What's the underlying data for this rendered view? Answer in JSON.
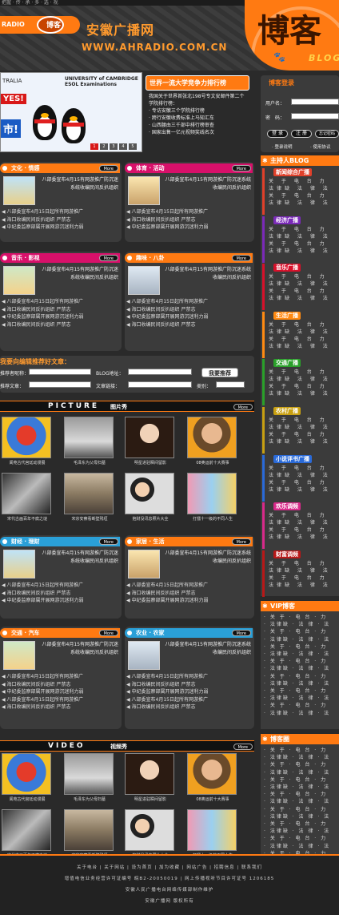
{
  "header": {
    "top_strip": "把握 · 传 · 承 · 多 · 选 · 视",
    "radio_logo_left": "RADIO",
    "radio_logo_right": "博客",
    "site_name": "安徽广播网",
    "site_url": "WWW.AHRADIO.COM.CN",
    "blog_big": "博客",
    "blog_small": "BLOG"
  },
  "banner": {
    "tralia": "TRALIA",
    "university": "UNIVERSITY of CAMBRIDGE ESOL Examinations",
    "yes_text": "YES!",
    "city_text": "市!",
    "pages": [
      "1",
      "2",
      "3",
      "4",
      "5"
    ]
  },
  "ranking": {
    "title": "世界一流大学竞争力排行榜",
    "intro": "我国关于世界首张北198号专文安邮件第二个学院排行榜：",
    "items": [
      "专访安徽三个学院排行榜",
      "跨行安徽收费标准上马知汇车",
      "山西腰由三千部中排行榜审查",
      "国家出售一亿元视频奖线名次"
    ]
  },
  "login": {
    "title": "博客登录",
    "user_label": "用户名：",
    "pass_label": "密　码：",
    "btn_login": "登 录",
    "btn_register": "注 册",
    "btn_forgot": "忘记密码",
    "help": "· 登录说明",
    "guide": "· 使用协议"
  },
  "host_blog": {
    "title": "主持人BLOG",
    "channels": [
      {
        "name": "新闻综合广播",
        "color": "#e0402a",
        "rows": [
          "关 于 电 台 力",
          "法律缺 法 律 法",
          "关 于 电 台 力",
          "法律缺 法 律 法"
        ]
      },
      {
        "name": "经济广播",
        "color": "#7a2ab8",
        "rows": [
          "关 于 电 台 力",
          "法律缺 法 律 法",
          "关 于 电 台 力",
          "法律缺 法 律 法"
        ]
      },
      {
        "name": "音乐广播",
        "color": "#d8102a",
        "rows": [
          "关 于 电 台 力",
          "法律缺 法 律 法",
          "关 于 电 台 力",
          "法律缺 法 律 法"
        ]
      },
      {
        "name": "生活广播",
        "color": "#ff8a12",
        "rows": [
          "关 于 电 台 力",
          "法律缺 法 律 法",
          "关 于 电 台 力",
          "法律缺 法 律 法"
        ]
      },
      {
        "name": "交通广播",
        "color": "#2aa02a",
        "rows": [
          "关 于 电 台 力",
          "法律缺 法 律 法",
          "关 于 电 台 力",
          "法律缺 法 律 法"
        ]
      },
      {
        "name": "农村广播",
        "color": "#c8a012",
        "rows": [
          "关 于 电 台 力",
          "法律缺 法 律 法",
          "关 于 电 台 力",
          "法律缺 法 律 法"
        ]
      },
      {
        "name": "小说评书广播",
        "color": "#2a6ad8",
        "rows": [
          "关 于 电 台 力",
          "法律缺 法 律 法",
          "关 于 电 台 力",
          "法律缺 法 律 法"
        ]
      },
      {
        "name": "欢乐调频",
        "color": "#d82a8a",
        "rows": [
          "关 于 电 台 力",
          "法律缺 法 律 法",
          "关 于 电 台 力",
          "法律缺 法 律 法"
        ]
      },
      {
        "name": "财富调频",
        "color": "#b81818",
        "rows": [
          "关 于 电 台 力",
          "法律缺 法 律 法",
          "关 于 电 台 力",
          "法律缺 法 律 法"
        ]
      }
    ]
  },
  "vip": {
    "title": "VIP博客",
    "rows": [
      "· 关 于 · 电 台 · 力",
      "· 法律缺 · 法 律 · 法",
      "· 关 于 · 电 台 · 力",
      "· 法律缺 · 法 律 · 法",
      "· 关 于 · 电 台 · 力",
      "· 法律缺 · 法 律 · 法",
      "· 关 于 · 电 台 · 力",
      "· 法律缺 · 法 律 · 法",
      "· 关 于 · 电 台 · 力",
      "· 法律缺 · 法 律 · 法",
      "· 关 于 · 电 台 · 力",
      "· 法律缺 · 法 律 · 法",
      "· 关 于 · 电 台 · 力",
      "· 法律缺 · 法 律 · 法"
    ]
  },
  "circle": {
    "title": "博客圈",
    "rows": [
      "· 关 于 · 电 台 · 力",
      "· 法律缺 · 法 律 · 法",
      "· 关 于 · 电 台 · 力",
      "· 法律缺 · 法 律 · 法",
      "· 关 于 · 电 台 · 力",
      "· 法律缺 · 法 律 · 法",
      "· 关 于 · 电 台 · 力",
      "· 法律缺 · 法 律 · 法",
      "· 关 于 · 电 台 · 力",
      "· 法律缺 · 法 律 · 法",
      "· 关 于 · 电 台 · 力",
      "· 法律缺 · 法 律 · 法",
      "· 关 于 · 电 台 · 力",
      "· 法律缺 · 法 律 · 法",
      "· 关 于 · 电 台 · 力",
      "· 法律缺 · 法 律 · 法"
    ]
  },
  "more_label": "More",
  "panels": {
    "culture": {
      "title": "文化 · 情感",
      "lead": "八部委宣布4月15有网游推广防沉迷系统收编民间反扒组织",
      "items": [
        "八部委宣布4月15日起所有网游推广",
        "海口收编民间反扒组织 严禁志",
        "中纪委监察部属开展网游沉迷利力弱"
      ]
    },
    "sports": {
      "title": "体育 · 活动",
      "lead": "八部委宣布4月15有网游推广防沉迷系统收编民间反扒组织",
      "items": [
        "八部委宣布4月15日起所有网游推广",
        "海口收编民间反扒组织 严禁志",
        "中纪委监察部属开展网游沉迷利力弱"
      ]
    },
    "music": {
      "title": "音乐 · 影视",
      "lead": "八部委宣布4月15有网游推广防沉迷系统收编民间反扒组织",
      "items": [
        "八部委宣布4月15日起所有网游推广",
        "海口收编民间反扒组织 严禁志",
        "中纪委监察部属开展网游沉迷利力弱",
        "海口收编民间反扒组织 严禁志"
      ]
    },
    "fun": {
      "title": "趣味 · 八卦",
      "lead": "八部委宣布4月15有网游推广防沉迷系统收编民间反扒组织",
      "items": [
        "八部委宣布4月15日起所有网游推广",
        "海口收编民间反扒组织 严禁志",
        "中纪委监察部属开展网游沉迷利力弱",
        "海口收编民间反扒组织 严禁志"
      ]
    },
    "finance": {
      "title": "财经 · 理财",
      "lead": "八部委宣布4月15有网游推广防沉迷系统收编民间反扒组织",
      "items": [
        "八部委宣布4月15日起所有网游推广",
        "海口收编民间反扒组织 严禁志",
        "中纪委监察部属开展网游沉迷利力弱"
      ]
    },
    "home": {
      "title": "家居 · 生活",
      "lead": "八部委宣布4月15有网游推广防沉迷系统收编民间反扒组织",
      "items": [
        "八部委宣布4月15日起所有网游推广",
        "海口收编民间反扒组织 严禁志",
        "中纪委监察部属开展网游沉迷利力弱"
      ]
    },
    "traffic": {
      "title": "交通 · 汽车",
      "lead": "八部委宣布4月15有网游推广防沉迷系统收编民间反扒组织",
      "items": [
        "八部委宣布4月15日起所有网游推广",
        "海口收编民间反扒组织 严禁志",
        "中纪委监察部属开展网游沉迷利力弱",
        "八部委宣布4月15日起所有网游推广",
        "海口收编民间反扒组织 严禁志"
      ]
    },
    "farm": {
      "title": "农业 · 农家",
      "lead": "八部委宣布4月15有网游推广防沉迷系统收编民间反扒组织",
      "items": [
        "八部委宣布4月15日起所有网游推广",
        "海口收编民间反扒组织 严禁志",
        "中纪委监察部属开展网游沉迷利力弱",
        "八部委宣布4月15日起所有网游推广",
        "海口收编民间反扒组织 严禁志"
      ]
    }
  },
  "recommend": {
    "title": "我要向编辑推荐好文章：",
    "name_label": "推荐者昵称：",
    "blog_label": "BLOG地址：",
    "article_label": "推荐文章：",
    "link_label": "文章链接：",
    "cat_label": "类别：",
    "button": "我要推荐"
  },
  "picture": {
    "en": "PICTURE",
    "cn": "图片秀",
    "captions": [
      "阆苑古代宫廷动漫展",
      "毛泽东为父母扫墓",
      "明星进驻瞬间留影",
      "08奥运前十大赛事",
      "宋代古画百年不腐之谜",
      "宋宗安察看断壁残垣",
      "抱财没讯息照片大全",
      "打擂十一级的不同人生"
    ]
  },
  "video": {
    "en": "VIDEO",
    "cn": "视频秀",
    "captions": [
      "阆苑古代宫廷动漫展",
      "毛泽东为父母扫墓",
      "明星进驻瞬间留影",
      "08奥运前十大赛事",
      "宋代古画百年不腐之谜",
      "宋宗安察看断壁残垣",
      "抱财没讯息照片大全",
      "打擂十一级的不同人生"
    ]
  },
  "footer": {
    "links": "关于电台 | 关于网站 | 设为首页 | 加为收藏 | 网站广告 | 招聘信息 | 联系我们",
    "license": "增值电信业务经营许可证编号 皖B2-20050019 | 网上传播视听节目许可证号 1206185",
    "owner": "安徽人民广播电台网络传媒部制作维护",
    "copy": "安徽广播网 版权所有"
  }
}
